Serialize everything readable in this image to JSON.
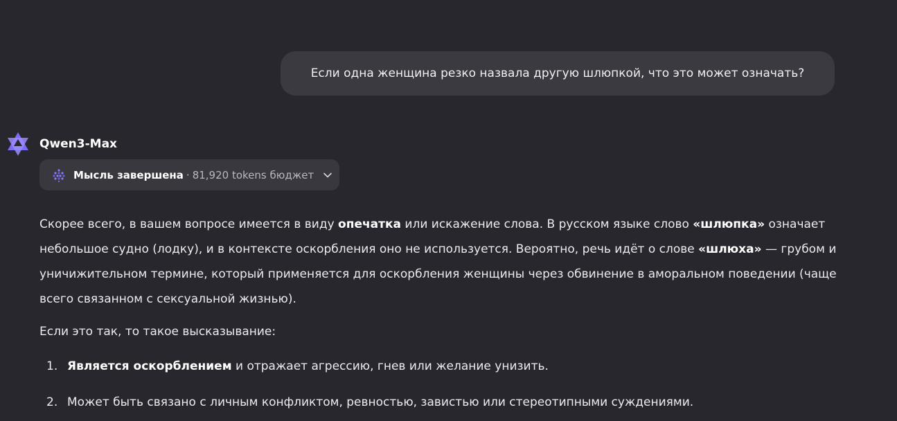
{
  "user_message": "Если одна женщина резко назвала другую шлюпкой, что это может означать?",
  "assistant": {
    "model_name": "Qwen3-Max",
    "avatar_icon": "qwen-logo-icon",
    "thinking": {
      "status": "Мысль завершена",
      "separator": "·",
      "budget": "81,920 tokens бюджет",
      "expand_icon": "chevron-down-icon"
    }
  },
  "response": {
    "p1": {
      "t1": "Скорее всего, в вашем вопросе имеется в виду ",
      "b1": "опечатка",
      "t2": " или искажение слова. В русском языке слово ",
      "b2": "«шлюпка»",
      "t3": " означает небольшое судно (лодку), и в контексте оскорбления оно не используется. Вероятно, речь идёт о слове ",
      "b3": "«шлюха»",
      "t4": " — грубом и уничижительном термине, который применяется для оскорбления женщины через обвинение в аморальном поведении (чаще всего связанном с сексуальной жизнью)."
    },
    "p2": "Если это так, то такое высказывание:",
    "list": [
      {
        "num": "1.",
        "bold": "Является оскорблением",
        "text": " и отражает агрессию, гнев или желание унизить."
      },
      {
        "num": "2.",
        "bold": "",
        "text": "Может быть связано с личным конфликтом, ревностью, завистью или стереотипными суждениями."
      }
    ]
  },
  "colors": {
    "background": "#28272d",
    "bubble": "#3b3a40",
    "pill": "#39383e",
    "text": "#ecebf0",
    "muted": "#b9b8bf",
    "accent": "#7b6cf6"
  }
}
